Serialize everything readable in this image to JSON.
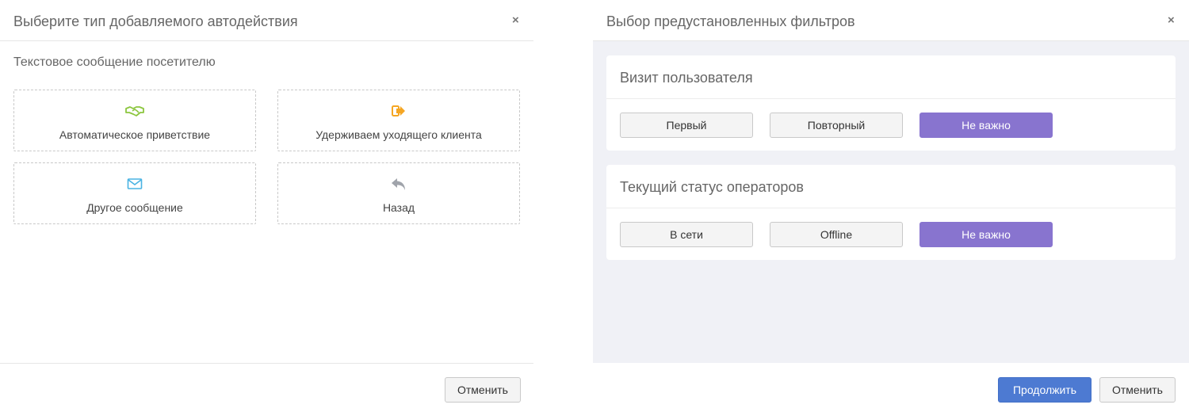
{
  "left": {
    "title": "Выберите тип добавляемого автодействия",
    "close": "×",
    "section": "Текстовое сообщение посетителю",
    "tiles": [
      {
        "label": "Автоматическое приветствие",
        "icon": "handshake-icon",
        "color": "#8cc63f"
      },
      {
        "label": "Удерживаем уходящего клиента",
        "icon": "sign-out-icon",
        "color": "#f5a623"
      },
      {
        "label": "Другое сообщение",
        "icon": "envelope-icon",
        "color": "#4ab3e3"
      },
      {
        "label": "Назад",
        "icon": "reply-icon",
        "color": "#a0a4ab"
      }
    ],
    "cancel": "Отменить"
  },
  "right": {
    "title": "Выбор предустановленных фильтров",
    "close": "×",
    "visit": {
      "title": "Визит пользователя",
      "options": [
        "Первый",
        "Повторный",
        "Не важно"
      ],
      "selected": "Не важно"
    },
    "status": {
      "title": "Текущий статус операторов",
      "options": [
        "В сети",
        "Offline",
        "Не важно"
      ],
      "selected": "Не важно"
    },
    "continue": "Продолжить",
    "cancel": "Отменить"
  },
  "colors": {
    "primary": "#4d7ad2",
    "selected": "#8874cf",
    "background": "#f0f1f6"
  }
}
